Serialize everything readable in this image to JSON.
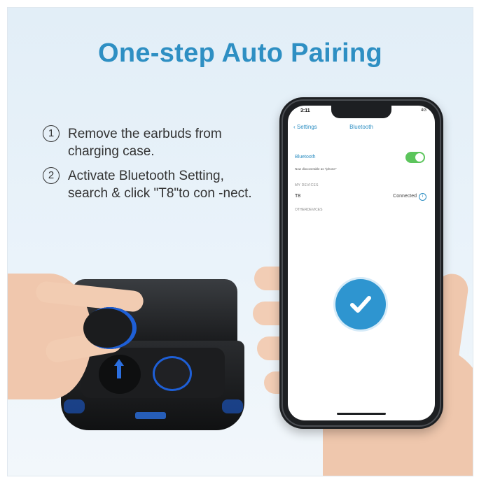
{
  "headline": "One-step Auto Pairing",
  "steps": [
    {
      "number": "1",
      "text": "Remove the earbuds from charging case."
    },
    {
      "number": "2",
      "text": "Activate Bluetooth Setting, search & click \"T8\"to con -nect."
    }
  ],
  "phone": {
    "status_time": "3:11",
    "status_right": "4G",
    "nav_back": "Settings",
    "nav_title": "Bluetooth",
    "bluetooth_label": "Bluetooth",
    "bluetooth_sub": "Now discoverable as \"iphone\"",
    "section_my_devices": "MY DEVICES",
    "device_name": "T8",
    "device_status": "Connected",
    "section_other_devices": "OTHERDEVICES"
  },
  "colors": {
    "accent": "#2e8fc3",
    "toggle_on": "#5cc55c",
    "check_circle": "#2e95d0"
  }
}
